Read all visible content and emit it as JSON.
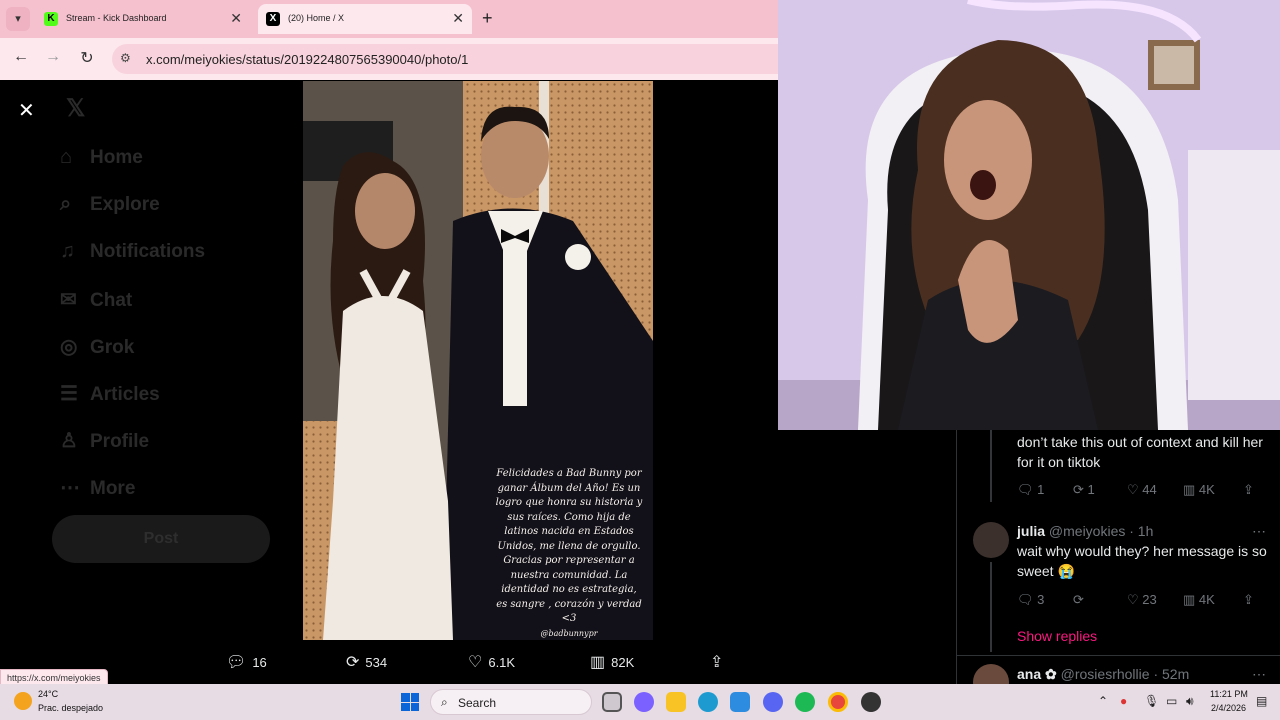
{
  "browser": {
    "tabs": [
      {
        "title": "Stream - Kick Dashboard",
        "favicon": "K"
      },
      {
        "title": "(20) Home / X",
        "favicon": "X"
      }
    ],
    "url": "x.com/meiyokies/status/2019224807565390040/photo/1",
    "status_url": "https://x.com/meiyokies"
  },
  "x_nav": {
    "items": [
      "Home",
      "Explore",
      "Notifications",
      "Chat",
      "Grok",
      "Articles",
      "Profile",
      "More"
    ],
    "post_label": "Post"
  },
  "photo": {
    "caption": "Felicidades a Bad Bunny por ganar Álbum del Año! Es un logro que honra su historia y sus raíces. Como hija de latinos nacida en Estados Unidos, me llena de orgullo. Gracias por representar a nuestra comunidad. La identidad no es estrategia, es sangre , corazón y verdad <3",
    "tag": "@badbunnypr"
  },
  "photo_actions": {
    "replies": "16",
    "reposts": "534",
    "likes": "6.1K",
    "views": "82K"
  },
  "replies": [
    {
      "text": "don’t take this out of context and kill her for it on tiktok",
      "stats": {
        "replies": "1",
        "reposts": "1",
        "likes": "44",
        "views": "4K"
      }
    },
    {
      "name": "julia",
      "handle": "@meiyokies",
      "time": "· 1h",
      "text": "wait why would they? her message is so sweet 😭",
      "stats": {
        "replies": "3",
        "reposts": "",
        "likes": "23",
        "views": "4K"
      }
    },
    {
      "name": "ana ✿",
      "handle": "@rosiesrhollie",
      "time": "· 52m"
    }
  ],
  "show_replies": "Show replies",
  "taskbar": {
    "temperature": "24°C",
    "weather": "Prac. despejado",
    "search": "Search",
    "time": "11:21 PM",
    "date": "2/4/2026"
  }
}
